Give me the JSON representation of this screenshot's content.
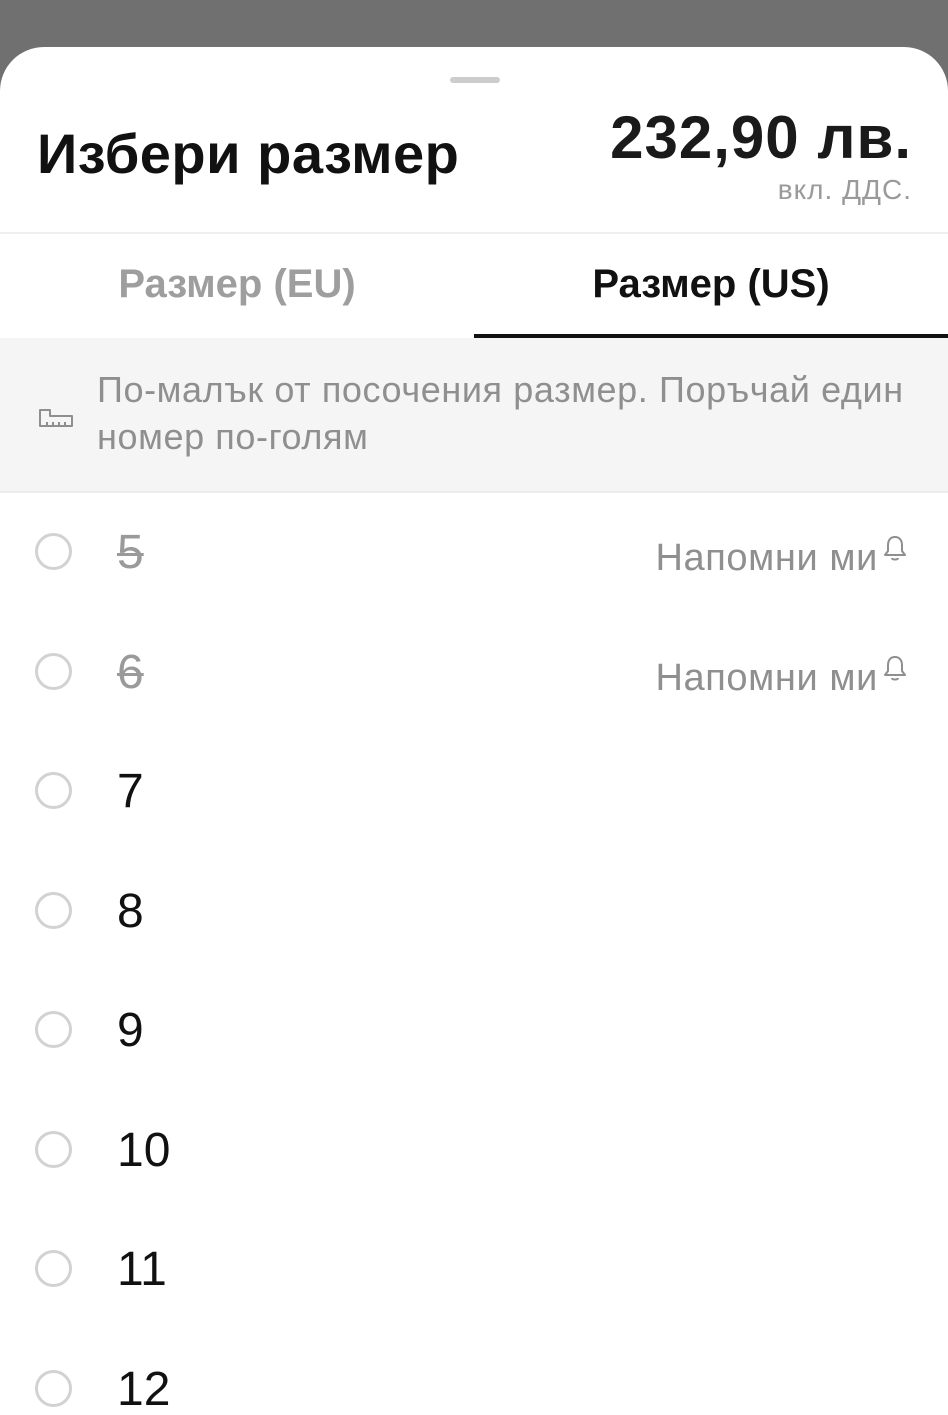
{
  "header": {
    "title": "Избери размер",
    "price": "232,90 лв.",
    "vat_note": "вкл. ДДС."
  },
  "tabs": [
    {
      "label": "Размер (EU)",
      "active": false
    },
    {
      "label": "Размер (US)",
      "active": true
    }
  ],
  "notice": {
    "icon": "ruler-icon",
    "text": "По-малък от посочения размер. Поръчай един номер по-голям"
  },
  "sizes": [
    {
      "label": "5",
      "available": false,
      "remind_label": "Напомни ми"
    },
    {
      "label": "6",
      "available": false,
      "remind_label": "Напомни ми"
    },
    {
      "label": "7",
      "available": true
    },
    {
      "label": "8",
      "available": true
    },
    {
      "label": "9",
      "available": true
    },
    {
      "label": "10",
      "available": true
    },
    {
      "label": "11",
      "available": true
    },
    {
      "label": "12",
      "available": true
    }
  ],
  "colors": {
    "accent": "#111111",
    "muted_text": "#8f8f8f",
    "notice_bg": "#f5f5f5",
    "overlay": "#707070"
  }
}
